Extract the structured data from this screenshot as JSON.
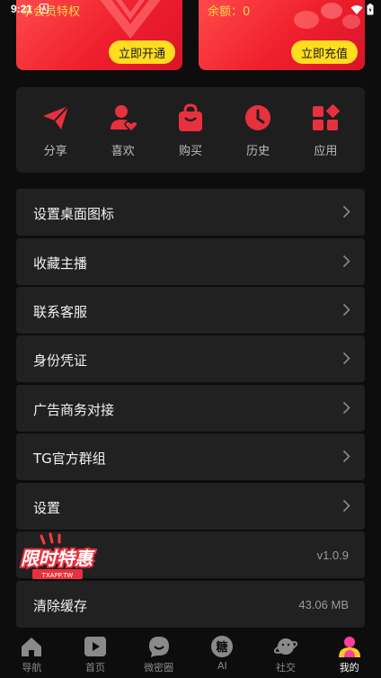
{
  "status_bar": {
    "time": "9:21"
  },
  "promo": {
    "vip_text": "享会员特权",
    "vip_button": "立即开通",
    "balance_text": "余额：0",
    "recharge_button": "立即充值"
  },
  "shortcuts": [
    {
      "label": "分享",
      "icon": "share-icon"
    },
    {
      "label": "喜欢",
      "icon": "like-user-icon"
    },
    {
      "label": "购买",
      "icon": "shopping-bag-icon"
    },
    {
      "label": "历史",
      "icon": "history-clock-icon"
    },
    {
      "label": "应用",
      "icon": "apps-icon"
    }
  ],
  "menu": {
    "desktop_icon": "设置桌面图标",
    "favorite_hosts": "收藏主播",
    "contact_service": "联系客服",
    "identity": "身份凭证",
    "ads_business": "广告商务对接",
    "tg_group": "TG官方群组",
    "settings": "设置",
    "version": "v1.0.9",
    "clear_cache": "清除缓存",
    "cache_size": "43.06 MB"
  },
  "badge": {
    "title": "限时特惠",
    "subtitle": "TXAPP.TW"
  },
  "nav": [
    {
      "label": "导航",
      "icon": "home-icon"
    },
    {
      "label": "首页",
      "icon": "play-icon"
    },
    {
      "label": "微密圈",
      "icon": "smile-chat-icon"
    },
    {
      "label": "AI",
      "icon": "ai-candy-icon"
    },
    {
      "label": "社交",
      "icon": "planet-icon"
    },
    {
      "label": "我的",
      "icon": "profile-avatar-icon"
    }
  ],
  "colors": {
    "accent": "#e8313e",
    "button_yellow": "#ffdd1f",
    "panel": "#1f1e1e",
    "row": "#222121"
  }
}
